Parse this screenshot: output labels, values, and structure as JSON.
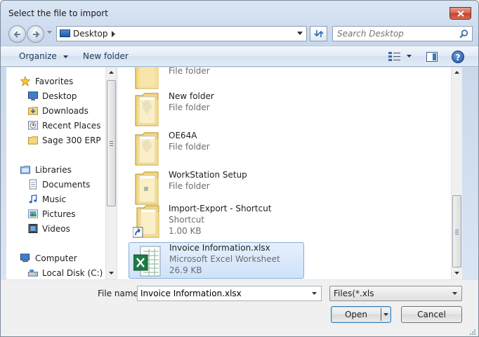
{
  "window": {
    "title": "Select the file to import"
  },
  "address": {
    "location": "Desktop"
  },
  "search": {
    "placeholder": "Search Desktop"
  },
  "toolbar": {
    "organize_label": "Organize",
    "new_folder_label": "New folder"
  },
  "nav": {
    "items": [
      {
        "label": "Favorites",
        "icon": "star-icon"
      },
      {
        "label": "Desktop",
        "icon": "desktop-icon"
      },
      {
        "label": "Downloads",
        "icon": "downloads-folder-icon"
      },
      {
        "label": "Recent Places",
        "icon": "recent-places-icon"
      },
      {
        "label": "Sage 300 ERP",
        "icon": "folder-icon"
      },
      {
        "label": "Libraries",
        "icon": "libraries-icon"
      },
      {
        "label": "Documents",
        "icon": "documents-icon"
      },
      {
        "label": "Music",
        "icon": "music-icon"
      },
      {
        "label": "Pictures",
        "icon": "pictures-icon"
      },
      {
        "label": "Videos",
        "icon": "videos-icon"
      },
      {
        "label": "Computer",
        "icon": "computer-icon"
      },
      {
        "label": "Local Disk (C:)",
        "icon": "local-disk-icon"
      }
    ]
  },
  "files": [
    {
      "name": "",
      "type": "File folder",
      "size": ""
    },
    {
      "name": "New folder",
      "type": "File folder",
      "size": ""
    },
    {
      "name": "OE64A",
      "type": "File folder",
      "size": ""
    },
    {
      "name": "WorkStation Setup",
      "type": "File folder",
      "size": ""
    },
    {
      "name": "Import-Export - Shortcut",
      "type": "Shortcut",
      "size": "1.00 KB"
    },
    {
      "name": "Invoice Information.xlsx",
      "type": "Microsoft Excel Worksheet",
      "size": "26.9 KB"
    }
  ],
  "footer": {
    "file_name_label": "File name:",
    "file_name_value": "Invoice Information.xlsx",
    "file_type_value": "Files(*.xls",
    "open_label": "Open",
    "cancel_label": "Cancel"
  },
  "colors": {
    "selection_bg": "#cfe2fa",
    "selection_border": "#84acdd",
    "folder_yellow": "#f3d77c",
    "excel_green": "#1e7b45"
  }
}
